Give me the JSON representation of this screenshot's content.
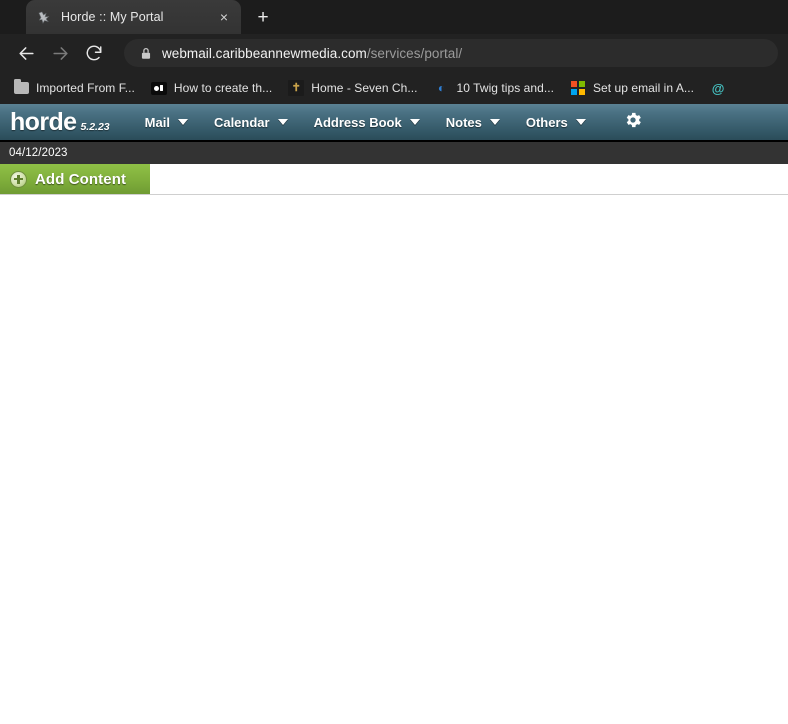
{
  "browser": {
    "tab": {
      "title": "Horde :: My Portal",
      "favicon_name": "horde-favicon",
      "close_label": "×"
    },
    "new_tab_label": "+",
    "toolbar": {
      "back_label": "back-arrow",
      "forward_label": "forward-arrow",
      "reload_label": "reload",
      "lock_label": "secure-lock"
    },
    "address": {
      "domain": "webmail.caribbeannewmedia.com",
      "path": "/services/portal/",
      "full": "webmail.caribbeannewmedia.com/services/portal/"
    },
    "bookmarks": [
      {
        "label": "Imported From F...",
        "icon": "folder-icon"
      },
      {
        "label": "How to create th...",
        "icon": "black-dots-icon"
      },
      {
        "label": "Home - Seven Ch...",
        "icon": "seven-figure-icon"
      },
      {
        "label": "10 Twig tips and...",
        "icon": "twig-blue-icon"
      },
      {
        "label": "Set up email in A...",
        "icon": "microsoft-logo-icon"
      },
      {
        "label": "",
        "icon": "teal-g-icon"
      }
    ]
  },
  "horde": {
    "logo": {
      "word": "horde",
      "version": "5.2.23"
    },
    "menu": [
      {
        "label": "Mail"
      },
      {
        "label": "Calendar"
      },
      {
        "label": "Address Book"
      },
      {
        "label": "Notes"
      },
      {
        "label": "Others"
      }
    ],
    "settings_icon": "gear-icon",
    "date": "04/12/2023",
    "add_content_label": "Add Content",
    "add_content_icon": "plus-circle-icon"
  },
  "colors": {
    "chrome_dark": "#222222",
    "tabstrip": "#1c1c1c",
    "horde_blue_top": "#5b8294",
    "horde_blue_bottom": "#2b4c59",
    "date_bar": "#333333",
    "green_button": "#7fae3b",
    "content_bg": "#ffffff"
  }
}
